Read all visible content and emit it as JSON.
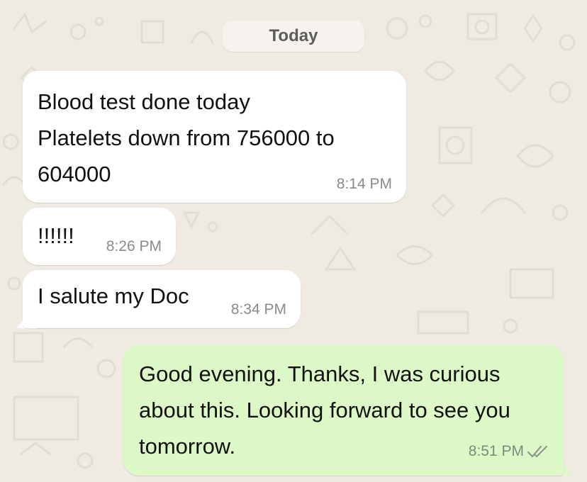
{
  "date_separator": "Today",
  "messages": [
    {
      "direction": "incoming",
      "text": "Blood test done today\nPlatelets down from 756000 to\n604000",
      "time": "8:14 PM"
    },
    {
      "direction": "incoming",
      "text": "!!!!!!",
      "time": "8:26 PM"
    },
    {
      "direction": "incoming",
      "text": "I salute my Doc",
      "time": "8:34 PM"
    },
    {
      "direction": "outgoing",
      "text": "Good evening. Thanks, I was curious\nabout this. Looking forward to see you\ntomorrow.",
      "time": "8:51 PM",
      "status_icon": "double-check-icon"
    }
  ],
  "colors": {
    "background": "#efeae2",
    "incoming_bubble": "#ffffff",
    "outgoing_bubble": "#dcf8c6",
    "read_ticks": "#8f9a8c"
  }
}
